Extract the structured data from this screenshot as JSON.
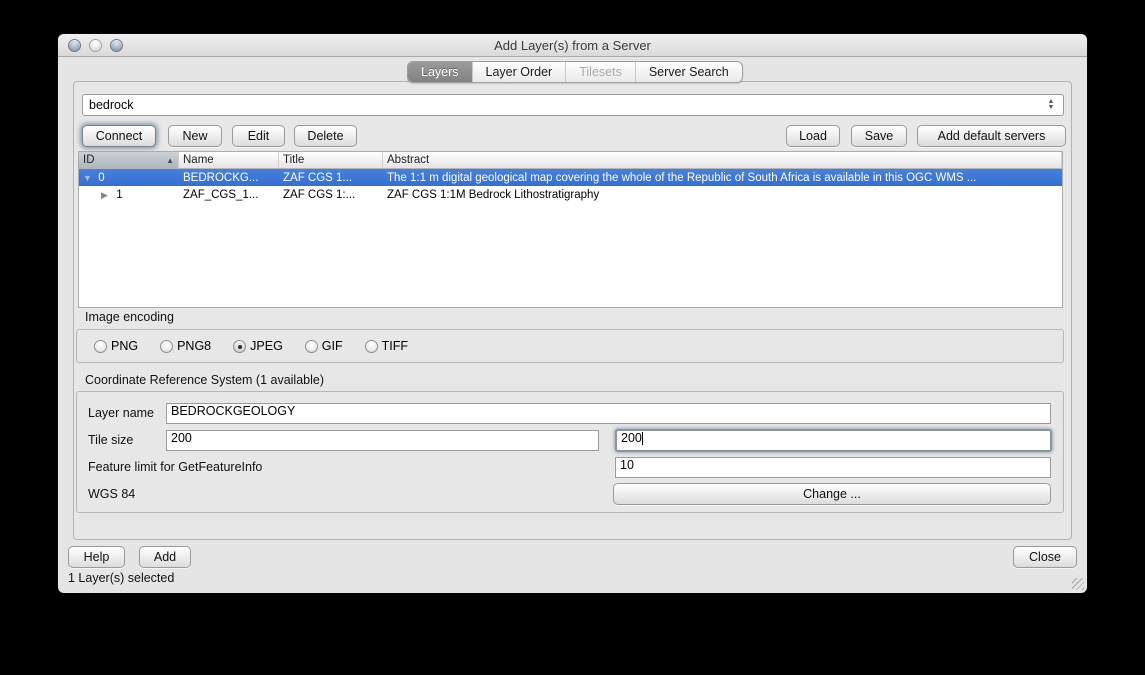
{
  "window": {
    "title": "Add Layer(s) from a Server",
    "status_text": "1 Layer(s) selected"
  },
  "tabs": [
    {
      "label": "Layers",
      "state": "selected"
    },
    {
      "label": "Layer Order",
      "state": "normal"
    },
    {
      "label": "Tilesets",
      "state": "disabled"
    },
    {
      "label": "Server Search",
      "state": "normal"
    }
  ],
  "server_combo": {
    "value": "bedrock"
  },
  "toolbar": {
    "connect": "Connect",
    "new": "New",
    "edit": "Edit",
    "delete": "Delete",
    "load": "Load",
    "save": "Save",
    "add_default_servers": "Add default servers"
  },
  "layer_table": {
    "columns": {
      "id": "ID",
      "name": "Name",
      "title": "Title",
      "abstract": "Abstract"
    },
    "sorted_column": "ID",
    "rows": [
      {
        "id": "0",
        "name": "BEDROCKG...",
        "title": "ZAF CGS 1...",
        "abstract": "The 1:1 m digital geological map covering the whole of the Republic of South Africa is available in this OGC WMS ...",
        "expanded": true,
        "selected": true
      },
      {
        "id": "1",
        "name": "ZAF_CGS_1...",
        "title": "ZAF CGS 1:...",
        "abstract": "ZAF CGS 1:1M Bedrock Lithostratigraphy",
        "expanded": false,
        "selected": false
      }
    ]
  },
  "image_encoding": {
    "label": "Image encoding",
    "options": [
      {
        "label": "PNG",
        "selected": false
      },
      {
        "label": "PNG8",
        "selected": false
      },
      {
        "label": "JPEG",
        "selected": true
      },
      {
        "label": "GIF",
        "selected": false
      },
      {
        "label": "TIFF",
        "selected": false
      }
    ]
  },
  "crs_section": {
    "label": "Coordinate Reference System (1 available)",
    "layer_name_label": "Layer name",
    "layer_name_value": "BEDROCKGEOLOGY",
    "tile_size_label": "Tile size",
    "tile_width_value": "200",
    "tile_height_value": "200",
    "feature_limit_label": "Feature limit for GetFeatureInfo",
    "feature_limit_value": "10",
    "crs_value": "WGS 84",
    "change_button": "Change ..."
  },
  "footer": {
    "help": "Help",
    "add": "Add",
    "close": "Close"
  },
  "colors": {
    "selection_blue": "#3b77d8",
    "tab_selected_gray": "#8a8a8a"
  }
}
